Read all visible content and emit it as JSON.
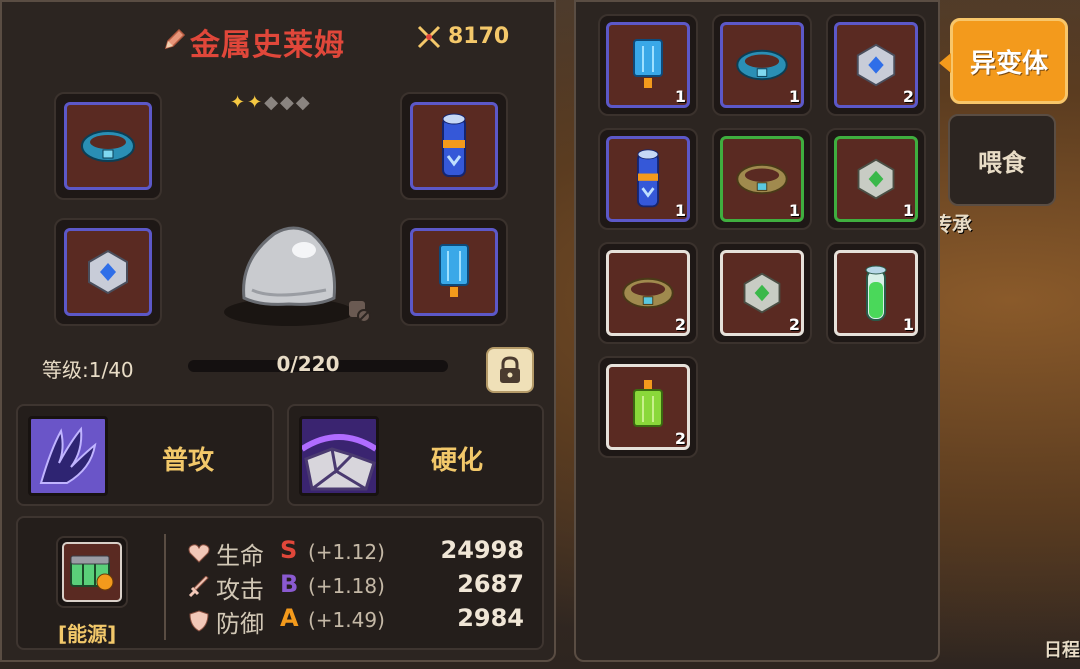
{
  "pet": {
    "name": "金属史莱姆",
    "power": "8170",
    "stars_filled": 2,
    "stars_total": 5,
    "level_label": "等级:1/40",
    "xp_text": "0/220",
    "xp_progress": 0
  },
  "skills": [
    {
      "name": "普攻",
      "icon": "claw-icon"
    },
    {
      "name": "硬化",
      "icon": "shell-icon"
    }
  ],
  "energy": {
    "label": "[能源]",
    "icon": "battery-icon"
  },
  "stats": [
    {
      "name": "生命",
      "grade": "S",
      "grade_color": "#e0473a",
      "growth": "(+1.12)",
      "value": "24998",
      "icon": "heart-icon"
    },
    {
      "name": "攻击",
      "grade": "B",
      "grade_color": "#8a5ad0",
      "growth": "(+1.18)",
      "value": "2687",
      "icon": "sword-icon"
    },
    {
      "name": "防御",
      "grade": "A",
      "grade_color": "#f39a1c",
      "growth": "(+1.49)",
      "value": "2984",
      "icon": "shield-icon"
    }
  ],
  "equipped": [
    {
      "slot": "top-left",
      "item": "blue-ring-icon"
    },
    {
      "slot": "top-right",
      "item": "blue-scroll-icon"
    },
    {
      "slot": "bottom-left",
      "item": "blue-gem-icon"
    },
    {
      "slot": "bottom-right",
      "item": "blue-armor-icon"
    }
  ],
  "inventory": [
    {
      "item": "blue-armor-icon",
      "rarity": "blue",
      "count": "1"
    },
    {
      "item": "blue-ring-icon",
      "rarity": "blue",
      "count": "1"
    },
    {
      "item": "blue-gem-icon",
      "rarity": "blue",
      "count": "2"
    },
    {
      "item": "blue-scroll-icon",
      "rarity": "blue",
      "count": "1"
    },
    {
      "item": "gold-ring-icon",
      "rarity": "green",
      "count": "1"
    },
    {
      "item": "green-gem-icon",
      "rarity": "green",
      "count": "1"
    },
    {
      "item": "gold-ring-icon",
      "rarity": "white",
      "count": "2"
    },
    {
      "item": "green-gem-icon",
      "rarity": "white",
      "count": "2"
    },
    {
      "item": "green-vial-icon",
      "rarity": "white",
      "count": "1"
    },
    {
      "item": "green-armor-icon",
      "rarity": "white",
      "count": "2"
    }
  ],
  "tabs": {
    "active": "异变体",
    "other": "喂食"
  },
  "background_text": {
    "partial_banner": "传承",
    "bottom_right": "日程"
  },
  "colors": {
    "accent": "#f39a1c",
    "name_red": "#e0473a",
    "gold_text": "#f2c86a",
    "rare_blue": "#5c58c8",
    "uncommon_green": "#3fae3f"
  }
}
